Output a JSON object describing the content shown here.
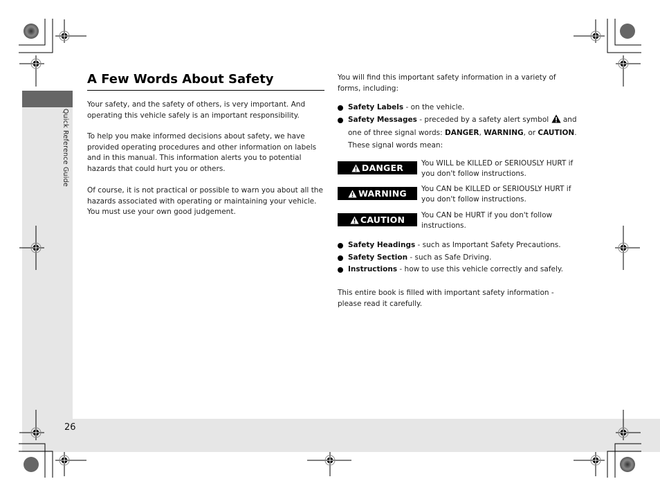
{
  "side_tab": {
    "label": "Quick Reference Guide"
  },
  "page_number": "26",
  "left_column": {
    "title": "A Few Words About Safety",
    "paragraphs": [
      "Your safety, and the safety of others, is very important. And operating this vehicle safely is an important responsibility.",
      "To help you make informed decisions about safety, we have provided operating procedures and other information on labels and in this manual. This information alerts you to potential hazards that could hurt you or others.",
      "Of course, it is not practical or possible to warn you about all the hazards associated with operating or maintaining your vehicle. You must use your own good judgement."
    ]
  },
  "right_column": {
    "intro": "You will find this important safety information in a variety of forms, including:",
    "bullets": [
      {
        "bold": "Safety Labels",
        "text": " - on the vehicle."
      },
      {
        "bold": "Safety Messages",
        "text_before": " - preceded by a safety alert symbol ",
        "icon": "warning-triangle-icon",
        "text_after": " and one of three signal words: ",
        "w1": "DANGER",
        "sep1": ", ",
        "w2": "WARNING",
        "sep2": ", or ",
        "w3": "CAUTION",
        "end": ". These signal words mean:"
      }
    ],
    "signals": [
      {
        "word": "DANGER",
        "meaning": "You WILL be KILLED or SERIOUSLY HURT if you don't follow instructions."
      },
      {
        "word": "WARNING",
        "meaning": "You CAN be KILLED or SERIOUSLY HURT if you don't follow instructions."
      },
      {
        "word": "CAUTION",
        "meaning": "You CAN be HURT if you don't follow instructions."
      }
    ],
    "bullets2": [
      {
        "bold": "Safety Headings",
        "text": " - such as Important Safety Precautions."
      },
      {
        "bold": "Safety Section",
        "text": " - such as Safe Driving."
      },
      {
        "bold": "Instructions",
        "text": " - how to use this vehicle correctly and safely."
      }
    ],
    "outro": "This entire book is filled with important safety information - please read it carefully."
  },
  "colors": {
    "tab_dark": "#666666",
    "strip_light": "#e6e6e6",
    "signal_bg": "#000000"
  }
}
